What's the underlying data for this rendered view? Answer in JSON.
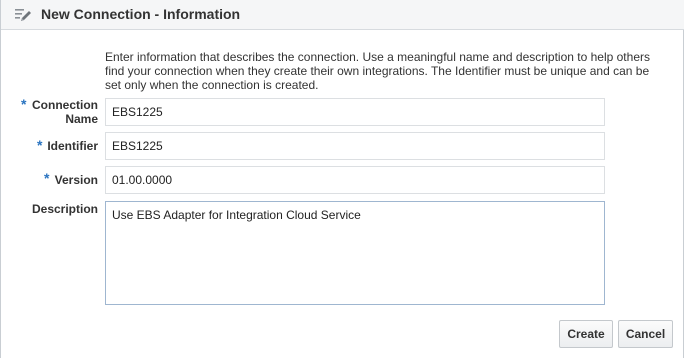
{
  "dialog": {
    "title": "New Connection - Information",
    "intro": "Enter information that describes the connection. Use a meaningful name and description to help others find your connection when they create their own integrations. The Identifier must be unique and can be set only when the connection is created."
  },
  "form": {
    "required_marker": "*",
    "connection_name": {
      "label_line1": "Connection",
      "label_line2": "Name",
      "value": "EBS1225"
    },
    "identifier": {
      "label": "Identifier",
      "value": "EBS1225"
    },
    "version": {
      "label": "Version",
      "value": "01.00.0000"
    },
    "description": {
      "label": "Description",
      "value": "Use EBS Adapter for Integration Cloud Service"
    }
  },
  "buttons": {
    "create": "Create",
    "cancel": "Cancel"
  },
  "icons": {
    "header": "edit-pencil-icon"
  },
  "colors": {
    "required_asterisk": "#2a74c0",
    "header_background": "#f5f6f7"
  }
}
